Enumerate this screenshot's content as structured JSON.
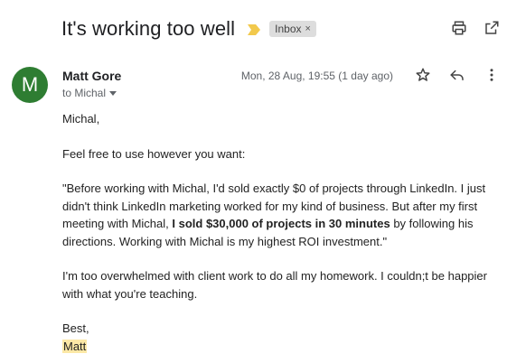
{
  "thread": {
    "subject": "It's working too well",
    "label": "Inbox",
    "label_remove": "×"
  },
  "message": {
    "avatar_letter": "M",
    "avatar_color": "#2e7d32",
    "sender_name": "Matt Gore",
    "recipient_line": "to Michal",
    "date": "Mon, 28 Aug, 19:55 (1 day ago)",
    "greeting": "Michal,",
    "para1": "Feel free to use however you want:",
    "para2_before": "\"Before working with Michal, I'd sold exactly $0 of projects through LinkedIn. I just didn't think LinkedIn marketing worked for my kind of business. But after my first meeting with Michal, ",
    "para2_bold": "I sold $30,000 of projects in 30 minutes",
    "para2_after": " by following his directions. Working with Michal is my highest ROI investment.\"",
    "para3": "I'm too overwhelmed with client work to do all my homework. I couldn;t be happier with what you're teaching.",
    "closing": "Best,",
    "signature": "Matt"
  },
  "icons": {
    "importance": "importance-marker-icon",
    "print": "print-icon",
    "open_new_window": "open-in-new-window-icon",
    "star": "star-icon",
    "reply": "reply-icon",
    "more": "more-vert-icon",
    "recipient_dropdown": "chevron-down-icon"
  },
  "colors": {
    "importance_marker": "#f2c94c",
    "signature_highlight": "#fce8a6"
  }
}
